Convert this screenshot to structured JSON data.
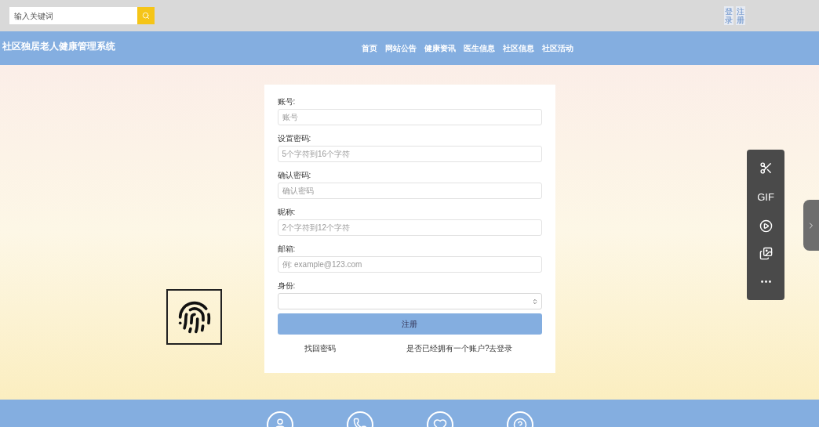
{
  "search": {
    "placeholder": "输入关键词"
  },
  "account_links": [
    "登录",
    "注册"
  ],
  "site_title": "社区独居老人健康管理系统",
  "nav": [
    {
      "label": "首页",
      "selected": false
    },
    {
      "label": "网站公告",
      "selected": false
    },
    {
      "label": "健康资讯",
      "selected": false
    },
    {
      "label": "医生信息",
      "selected": false
    },
    {
      "label": "社区信息",
      "selected": false
    },
    {
      "label": "社区活动",
      "selected": false
    }
  ],
  "form": {
    "fields": [
      {
        "kind": "input",
        "label": "账号:",
        "placeholder": "账号"
      },
      {
        "kind": "input",
        "label": "设置密码:",
        "placeholder": "5个字符到16个字符"
      },
      {
        "kind": "input",
        "label": "确认密码:",
        "placeholder": "确认密码"
      },
      {
        "kind": "input",
        "label": "昵称:",
        "placeholder": "2个字符到12个字符"
      },
      {
        "kind": "input",
        "label": "邮箱:",
        "placeholder": "例: example@123.com"
      },
      {
        "kind": "select",
        "label": "身份:"
      }
    ],
    "submit": "注册",
    "links": [
      "找回密码",
      "是否已经拥有一个账户?去登录"
    ]
  },
  "toolbar": [
    {
      "kind": "icon"
    },
    {
      "kind": "text",
      "label": "GIF"
    },
    {
      "kind": "icon"
    },
    {
      "kind": "icon"
    },
    {
      "kind": "icon"
    }
  ]
}
